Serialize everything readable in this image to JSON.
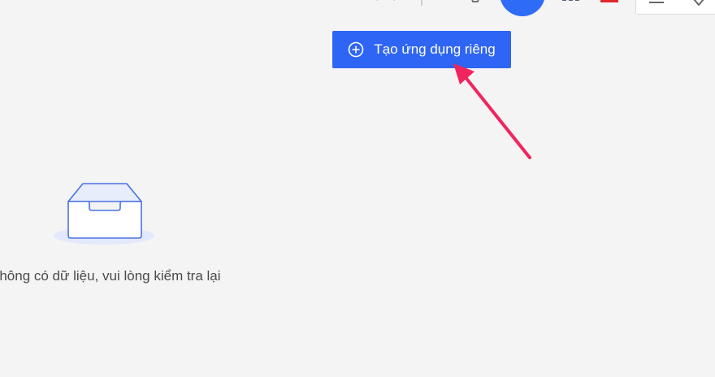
{
  "header": {
    "avatar_color": "#2e6bf6",
    "flag_color": "#e0262b"
  },
  "main": {
    "create_button_label": "Tạo ứng dụng riêng",
    "create_button_icon": "plus-circle-icon",
    "empty_state_text": "Không có dữ liệu, vui lòng kiểm tra lại",
    "empty_state_icon": "empty-inbox-icon"
  },
  "colors": {
    "accent": "#2e65f4",
    "annotation_arrow": "#f0245e",
    "background": "#f4f4f4"
  }
}
